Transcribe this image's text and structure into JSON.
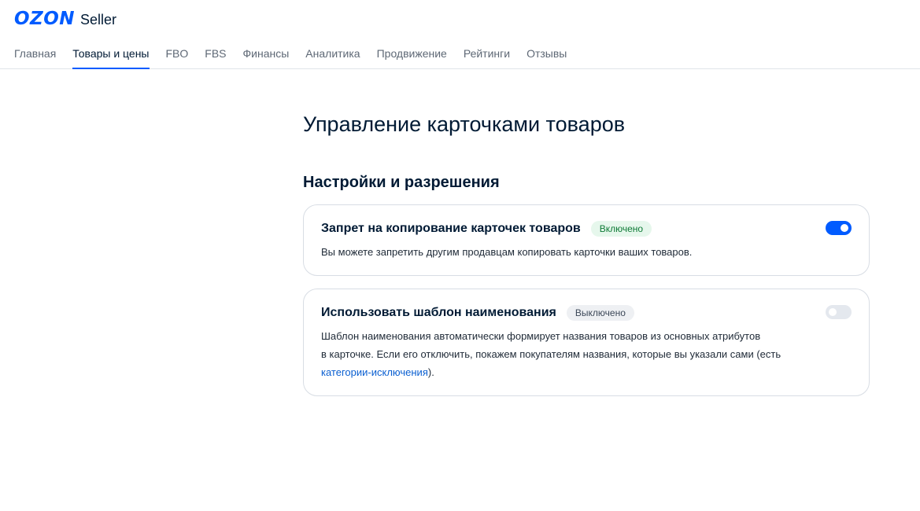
{
  "brand": {
    "logo": "OZON",
    "product": "Seller"
  },
  "nav": [
    {
      "label": "Главная",
      "active": false
    },
    {
      "label": "Товары и цены",
      "active": true
    },
    {
      "label": "FBO",
      "active": false
    },
    {
      "label": "FBS",
      "active": false
    },
    {
      "label": "Финансы",
      "active": false
    },
    {
      "label": "Аналитика",
      "active": false
    },
    {
      "label": "Продвижение",
      "active": false
    },
    {
      "label": "Рейтинги",
      "active": false
    },
    {
      "label": "Отзывы",
      "active": false
    }
  ],
  "page": {
    "title": "Управление карточками товаров",
    "section_title": "Настройки и разрешения"
  },
  "settings": [
    {
      "title": "Запрет на копирование карточек товаров",
      "status": "Включено",
      "enabled": true,
      "description": "Вы можете запретить другим продавцам копировать карточки ваших товаров."
    },
    {
      "title": "Использовать шаблон наименования",
      "status": "Выключено",
      "enabled": false,
      "description_line1": "Шаблон наименования автоматически формирует названия товаров из основных атрибутов",
      "description_line2": "в карточке. Если его отключить, покажем покупателям названия, которые вы указали сами (есть",
      "link": "категории-исключения",
      "description_end": ")."
    }
  ],
  "colors": {
    "accent": "#005bff",
    "on_badge": "#e6f7ec",
    "off_badge": "#eef0f3"
  }
}
